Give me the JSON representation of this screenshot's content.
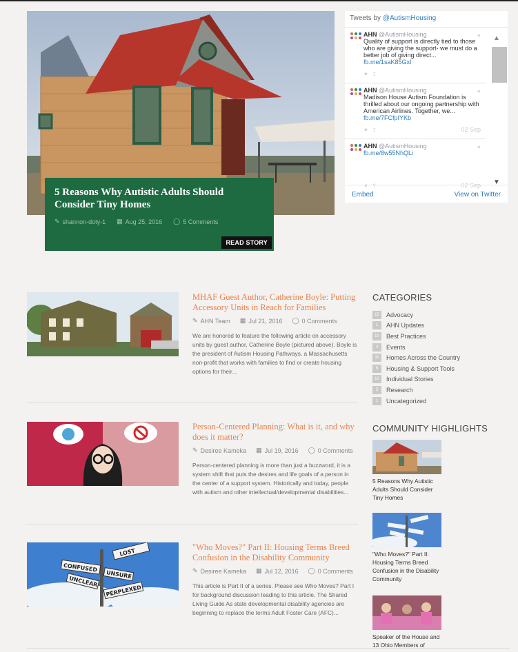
{
  "hero": {
    "title": "5 Reasons Why Autistic Adults Should Consider Tiny Homes",
    "author": "shannon-doty-1",
    "date": "Aug 25, 2016",
    "comments": "5 Comments",
    "read_label": "READ STORY"
  },
  "twitter": {
    "header_prefix": "Tweets",
    "header_by": "by",
    "header_handle": "@AutismHousing",
    "tweets": [
      {
        "name": "AHN",
        "handle": "@AutismHousing",
        "text": "Quality of support is directly tied to those who are giving the support- we must do a better job of giving direct...",
        "link": "fb.me/1saK85GxI",
        "date": ""
      },
      {
        "name": "AHN",
        "handle": "@AutismHousing",
        "text": "Madison House Autism Foundation is thrilled about our ongoing partnership with American Airlines. Together, we...",
        "link": "fb.me/7FCfpIYKb",
        "date": "02 Sep"
      },
      {
        "name": "AHN",
        "handle": "@AutismHousing",
        "text": "",
        "link": "fb.me/8w55NhQLi",
        "date": "02 Sep"
      }
    ],
    "embed_label": "Embed",
    "view_label": "View on Twitter"
  },
  "articles": [
    {
      "title": "MHAF Guest Author, Catherine Boyle: Putting Accessory Units in Reach for Families",
      "author": "AHN Team",
      "date": "Jul 21, 2016",
      "comments": "0 Comments",
      "excerpt": "We are honored to feature the following article on accessory units by guest author, Catherine Boyle (pictured above). Boyle is the president of Autism Housing Pathways, a Massachusetts non-profit that works with families to find or create housing options for their..."
    },
    {
      "title": "Person-Centered Planning: What is it, and why does it matter?",
      "author": "Desiree Kameka",
      "date": "Jul 19, 2016",
      "comments": "0 Comments",
      "excerpt": "Person-centered planning is more than just a buzzword, it is a system shift that puts the desires and life goals of a person in the center of a support system. Historically and today, people with autism and other intellectual/developmental disabilities..."
    },
    {
      "title": "\"Who Moves?\" Part II: Housing Terms Breed Confusion in the Disability Community",
      "author": "Desiree Kameka",
      "date": "Jul 12, 2016",
      "comments": "0 Comments",
      "excerpt": "This article is Part II of a series. Please see Who Moves? Part I for background discussion leading to this article. The Shared Living Guide As state developmental disability agencies are beginning to replace the terms Adult Foster Care (AFC)..."
    }
  ],
  "sign_words": [
    "LOST",
    "CONFUSED",
    "UNSURE",
    "UNCLEAR",
    "PERPLEXED"
  ],
  "sidebar": {
    "categories_heading": "CATEGORIES",
    "categories": [
      {
        "count": "15",
        "label": "Advocacy"
      },
      {
        "count": "1",
        "label": "AHN Updates"
      },
      {
        "count": "10",
        "label": "Best Practices"
      },
      {
        "count": "4",
        "label": "Events"
      },
      {
        "count": "11",
        "label": "Homes Across the Country"
      },
      {
        "count": "6",
        "label": "Housing & Support Tools"
      },
      {
        "count": "10",
        "label": "Individual Stories"
      },
      {
        "count": "5",
        "label": "Research"
      },
      {
        "count": "1",
        "label": "Uncategorized"
      }
    ],
    "highlights_heading": "COMMUNITY HIGHLIGHTS",
    "highlights": [
      {
        "caption": "5 Reasons Why Autistic Adults Should Consider Tiny Homes"
      },
      {
        "caption": "\"Who Moves?\" Part II: Housing Terms Breed Confusion in the Disability Community"
      },
      {
        "caption": "Speaker of the House and 13 Ohio Members of"
      }
    ]
  },
  "colors": {
    "accent": "#e8814d",
    "hero_card": "#1e6b42",
    "twitter_link": "#2b7bb9"
  }
}
